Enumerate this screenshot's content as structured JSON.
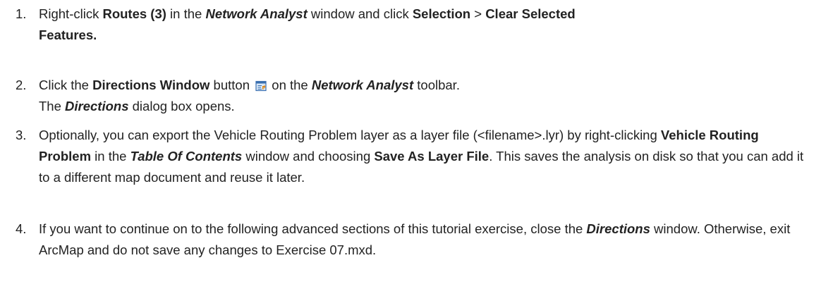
{
  "steps": [
    {
      "number": "1.",
      "parts": [
        {
          "t": "Right-click ",
          "s": "n"
        },
        {
          "t": "Routes (3)",
          "s": "b"
        },
        {
          "t": " in the ",
          "s": "n"
        },
        {
          "t": "Network Analyst",
          "s": "bi"
        },
        {
          "t": " window and click ",
          "s": "n"
        },
        {
          "t": "Selection",
          "s": "b"
        },
        {
          "t": " > ",
          "s": "n"
        },
        {
          "t": "Clear Selected Features.",
          "s": "b"
        }
      ]
    },
    {
      "number": "2.",
      "parts": [
        {
          "t": "Click the ",
          "s": "n"
        },
        {
          "t": "Directions Window",
          "s": "b"
        },
        {
          "t": " button ",
          "s": "n"
        },
        {
          "icon": "directions-window-icon"
        },
        {
          "t": " on the ",
          "s": "n"
        },
        {
          "t": "Network Analyst",
          "s": "bi"
        },
        {
          "t": " toolbar.",
          "s": "n"
        }
      ],
      "result": [
        {
          "t": "The ",
          "s": "n"
        },
        {
          "t": "Directions",
          "s": "bi"
        },
        {
          "t": " dialog box opens.",
          "s": "n"
        }
      ]
    },
    {
      "number": "3.",
      "parts": [
        {
          "t": "Optionally, you can export the Vehicle Routing Problem layer as a layer file (<filename>.lyr) by right-clicking ",
          "s": "n"
        },
        {
          "t": "Vehicle Routing Problem",
          "s": "b"
        },
        {
          "t": " in the ",
          "s": "n"
        },
        {
          "t": "Table Of Contents",
          "s": "bi"
        },
        {
          "t": " window and choosing ",
          "s": "n"
        },
        {
          "t": "Save As Layer File",
          "s": "b"
        },
        {
          "t": ". This saves the analysis on disk so that you can add it to a different map document and reuse it later.",
          "s": "n"
        }
      ]
    },
    {
      "number": "4.",
      "parts": [
        {
          "t": "If you want to continue on to the following advanced sections of this tutorial exercise, close the ",
          "s": "n"
        },
        {
          "t": "Directions",
          "s": "bi"
        },
        {
          "t": " window. Otherwise, exit ArcMap and do not save any changes to Exercise 07.mxd.",
          "s": "n"
        }
      ]
    }
  ],
  "colors": {
    "text": "#222222",
    "icon_frame": "#3a6fb0",
    "icon_fill": "#d9e8f7",
    "icon_arrow": "#e08a1a"
  }
}
